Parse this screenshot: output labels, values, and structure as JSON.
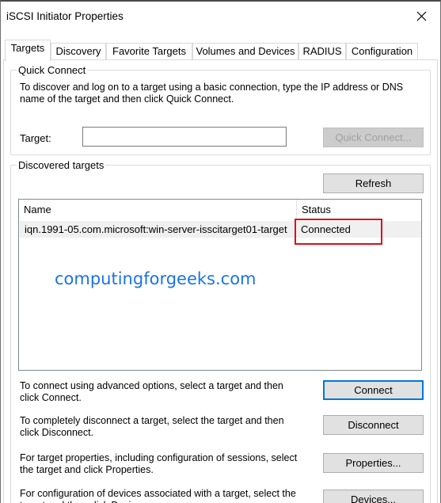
{
  "window": {
    "title": "iSCSI Initiator Properties"
  },
  "tabs": [
    {
      "label": "Targets"
    },
    {
      "label": "Discovery"
    },
    {
      "label": "Favorite Targets"
    },
    {
      "label": "Volumes and Devices"
    },
    {
      "label": "RADIUS"
    },
    {
      "label": "Configuration"
    }
  ],
  "quick_connect": {
    "legend": "Quick Connect",
    "description": "To discover and log on to a target using a basic connection, type the IP address or DNS name of the target and then click Quick Connect.",
    "target_label": "Target:",
    "target_value": "",
    "button_label": "Quick Connect..."
  },
  "discovered": {
    "legend": "Discovered targets",
    "refresh_label": "Refresh",
    "columns": {
      "name": "Name",
      "status": "Status"
    },
    "rows": [
      {
        "name": "iqn.1991-05.com.microsoft:win-server-isscitarget01-target",
        "status": "Connected"
      }
    ]
  },
  "watermark": "computingforgeeks.com",
  "actions": [
    {
      "text": "To connect using advanced options, select a target and then click Connect.",
      "button": "Connect"
    },
    {
      "text": "To completely disconnect a target, select the target and then click Disconnect.",
      "button": "Disconnect"
    },
    {
      "text": "For target properties, including configuration of sessions, select the target and click Properties.",
      "button": "Properties..."
    },
    {
      "text": "For configuration of devices associated with a target, select the target and then click Devices.",
      "button": "Devices..."
    }
  ],
  "colors": {
    "highlight": "#d9101a",
    "focus": "#0078d7",
    "watermark": "#1a73e8"
  }
}
